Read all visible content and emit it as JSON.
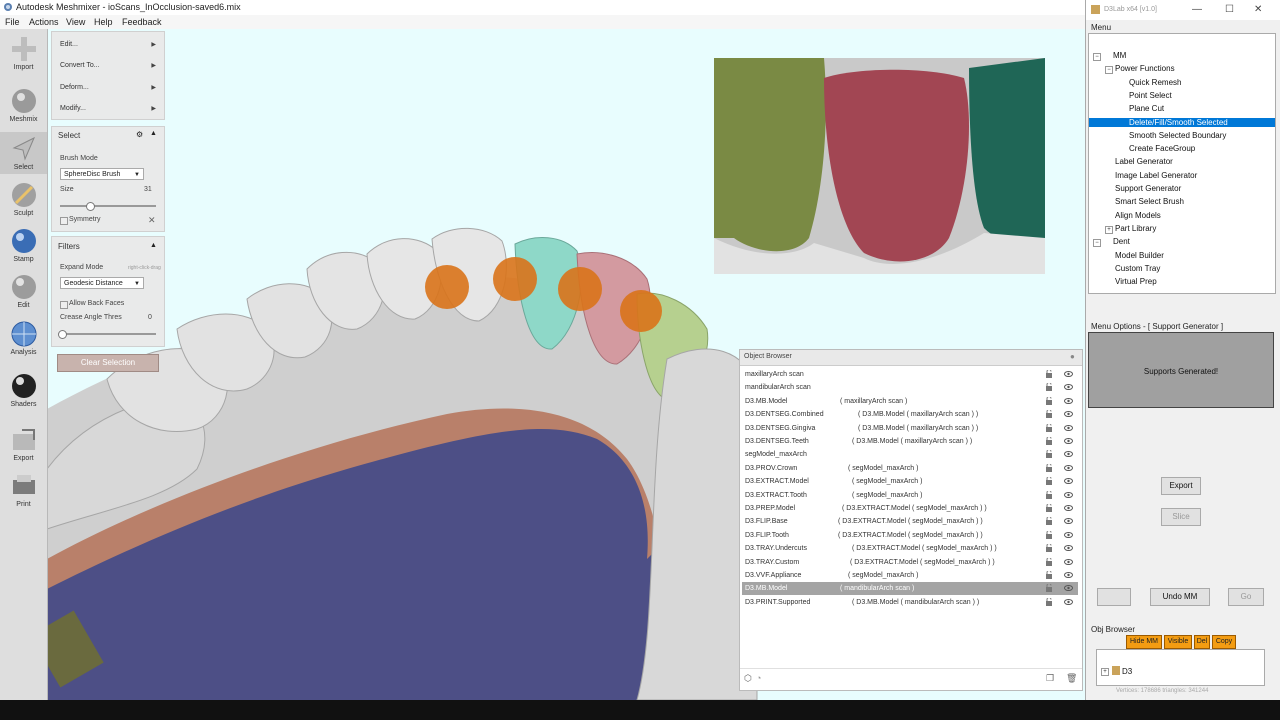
{
  "window": {
    "title": "Autodesk Meshmixer - ioScans_InOcclusion-saved6.mix"
  },
  "menubar": [
    "File",
    "Actions",
    "View",
    "Help",
    "Feedback"
  ],
  "tools": [
    {
      "label": "Import",
      "icon": "plus-icon"
    },
    {
      "label": "Meshmix",
      "icon": "meshmix-ball-icon"
    },
    {
      "label": "Select",
      "icon": "select-arrow-icon"
    },
    {
      "label": "Sculpt",
      "icon": "sculpt-brush-icon"
    },
    {
      "label": "Stamp",
      "icon": "stamp-icon"
    },
    {
      "label": "Edit",
      "icon": "edit-ball-icon"
    },
    {
      "label": "Analysis",
      "icon": "analysis-globe-icon"
    },
    {
      "label": "Shaders",
      "icon": "shader-sphere-icon"
    },
    {
      "label": "Export",
      "icon": "export-icon"
    },
    {
      "label": "Print",
      "icon": "printer-icon"
    }
  ],
  "panel": {
    "menu_items": [
      "Edit...",
      "Convert To...",
      "Deform...",
      "Modify..."
    ],
    "select_header": "Select",
    "brush_mode_label": "Brush Mode",
    "brush_mode_value": "SphereDisc Brush",
    "size_label": "Size",
    "size_value": "31",
    "symmetry_label": "Symmetry",
    "filters_header": "Filters",
    "expand_mode_label": "Expand Mode",
    "expand_mode_hint": "right-click-drag",
    "expand_mode_value": "Geodesic Distance",
    "allow_back_faces_label": "Allow Back Faces",
    "crease_label": "Crease Angle Thres",
    "crease_value": "0",
    "clear_selection_label": "Clear Selection"
  },
  "object_browser": {
    "title": "Object Browser",
    "rows": [
      {
        "name": "maxillaryArch scan",
        "parent": ""
      },
      {
        "name": "mandibularArch scan",
        "parent": ""
      },
      {
        "name": "D3.MB.Model",
        "parent": "( maxillaryArch scan )"
      },
      {
        "name": "D3.DENTSEG.Combined",
        "parent": "( D3.MB.Model ( maxillaryArch scan ) )"
      },
      {
        "name": "D3.DENTSEG.Gingiva",
        "parent": "( D3.MB.Model ( maxillaryArch scan ) )"
      },
      {
        "name": "D3.DENTSEG.Teeth",
        "parent": "( D3.MB.Model ( maxillaryArch scan ) )"
      },
      {
        "name": "segModel_maxArch",
        "parent": ""
      },
      {
        "name": "D3.PROV.Crown",
        "parent": "( segModel_maxArch )"
      },
      {
        "name": "D3.EXTRACT.Model",
        "parent": "( segModel_maxArch )"
      },
      {
        "name": "D3.EXTRACT.Tooth",
        "parent": "( segModel_maxArch )"
      },
      {
        "name": "D3.PREP.Model",
        "parent": "( D3.EXTRACT.Model ( segModel_maxArch ) )"
      },
      {
        "name": "D3.FLIP.Base",
        "parent": "( D3.EXTRACT.Model ( segModel_maxArch ) )"
      },
      {
        "name": "D3.FLIP.Tooth",
        "parent": "( D3.EXTRACT.Model ( segModel_maxArch ) )"
      },
      {
        "name": "D3.TRAY.Undercuts",
        "parent": "( D3.EXTRACT.Model ( segModel_maxArch ) )"
      },
      {
        "name": "D3.TRAY.Custom",
        "parent": "( D3.EXTRACT.Model ( segModel_maxArch ) )"
      },
      {
        "name": "D3.VVF.Appliance",
        "parent": "( segModel_maxArch )"
      },
      {
        "name": "D3.MB.Model",
        "parent": "( mandibularArch scan )",
        "selected": true
      },
      {
        "name": "D3.PRINT.Supported",
        "parent": "( D3.MB.Model ( mandibularArch scan ) )"
      }
    ]
  },
  "d3lab": {
    "title": "D3Lab x64 [v1.0]",
    "menu_label": "Menu",
    "tree": [
      {
        "label": "MM",
        "level": 0,
        "expander": "−"
      },
      {
        "label": "Power Functions",
        "level": 1,
        "expander": "−"
      },
      {
        "label": "Quick Remesh",
        "level": 2
      },
      {
        "label": "Point Select",
        "level": 2
      },
      {
        "label": "Plane Cut",
        "level": 2
      },
      {
        "label": "Delete/Fill/Smooth Selected",
        "level": 2,
        "selected": true
      },
      {
        "label": "Smooth Selected Boundary",
        "level": 2
      },
      {
        "label": "Create FaceGroup",
        "level": 2
      },
      {
        "label": "Label Generator",
        "level": 1
      },
      {
        "label": "Image Label Generator",
        "level": 1
      },
      {
        "label": "Support Generator",
        "level": 1
      },
      {
        "label": "Smart Select Brush",
        "level": 1
      },
      {
        "label": "Align Models",
        "level": 1
      },
      {
        "label": "Part Library",
        "level": 1,
        "expander": "+"
      },
      {
        "label": "Dent",
        "level": 0,
        "expander": "−"
      },
      {
        "label": "Model Builder",
        "level": 1
      },
      {
        "label": "Custom Tray",
        "level": 1
      },
      {
        "label": "Virtual Prep",
        "level": 1
      }
    ],
    "options_label": "Menu Options - [ Support Generator ]",
    "options_message": "Supports Generated!",
    "export_label": "Export",
    "slice_label": "Slice",
    "undo_label": "Undo MM",
    "go_label": "Go",
    "obj_browser_label": "Obj Browser",
    "obj_buttons": [
      "Hide MM",
      "Visible",
      "Del",
      "Copy"
    ],
    "obj_tree_root": "D3",
    "status": "Vertices: 178686 triangles: 341244"
  }
}
